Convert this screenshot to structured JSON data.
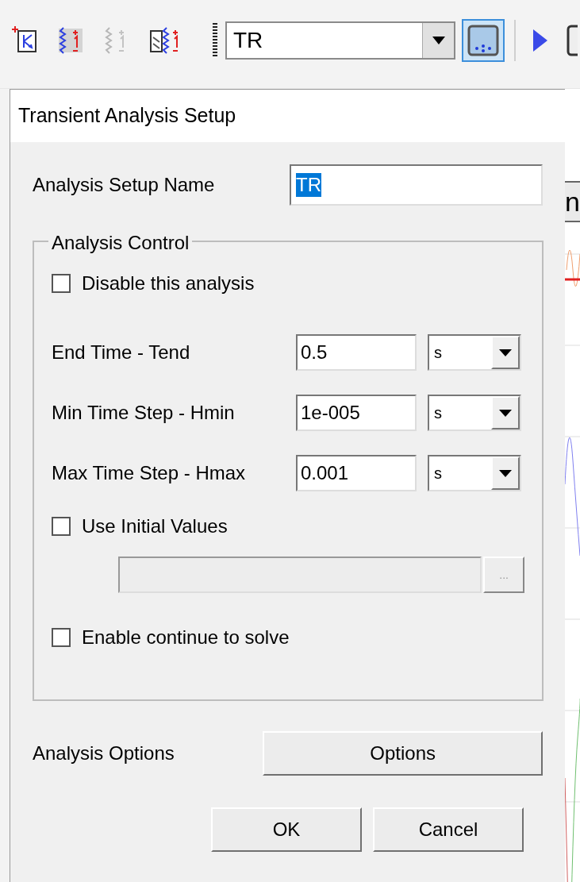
{
  "toolbar": {
    "tools": [
      {
        "kind": "transistor",
        "disabled": false
      },
      {
        "kind": "probe",
        "disabled": false
      },
      {
        "kind": "probe",
        "disabled": true
      },
      {
        "kind": "switch-probe",
        "disabled": false
      }
    ],
    "setup_select": {
      "value": "TR"
    },
    "setup_button": {
      "selected": true
    },
    "run_button": {
      "disabled": false
    }
  },
  "background": {
    "cut_text": "n"
  },
  "dialog": {
    "title": "Transient Analysis Setup",
    "setup_name": {
      "label": "Analysis Setup Name",
      "value": "TR",
      "text_selected": true
    },
    "analysis_control": {
      "title": "Analysis Control",
      "disable": {
        "label": "Disable this analysis",
        "checked": false
      },
      "params": [
        {
          "label": "End Time - Tend",
          "value": "0.5",
          "unit": "s"
        },
        {
          "label": "Min Time Step - Hmin",
          "value": "1e-005",
          "unit": "s"
        },
        {
          "label": "Max Time Step - Hmax",
          "value": "0.001",
          "unit": "s"
        }
      ],
      "use_initial": {
        "label": "Use Initial Values",
        "checked": false
      },
      "initial_file": {
        "disabled": true,
        "browse": "..."
      },
      "enable_continue": {
        "label": "Enable continue to solve",
        "checked": false
      }
    },
    "options_label": "Analysis Options",
    "options_button": "Options",
    "buttons": [
      "OK",
      "Cancel"
    ]
  }
}
